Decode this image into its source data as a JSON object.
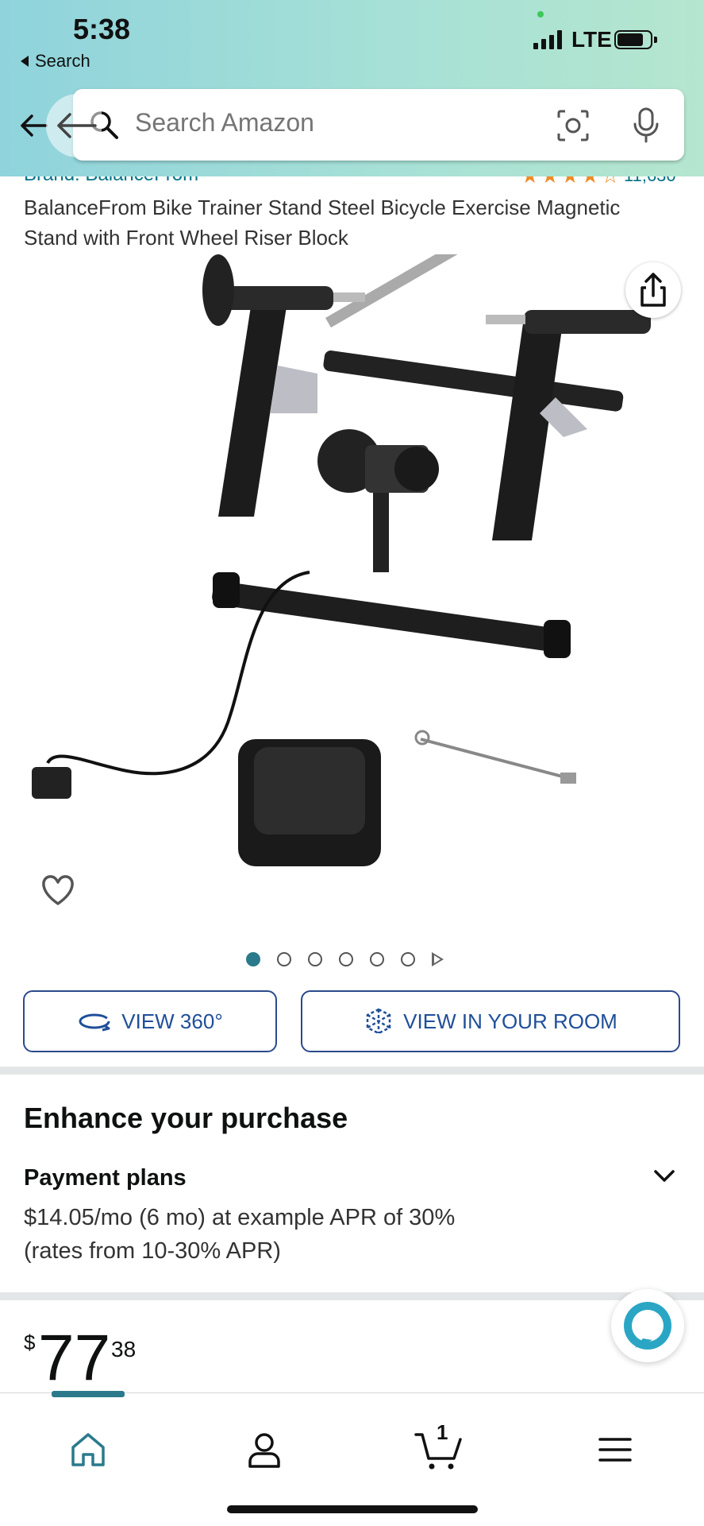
{
  "status_bar": {
    "time": "5:38",
    "back_app_label": "Search",
    "network": "LTE"
  },
  "search": {
    "placeholder": "Search Amazon"
  },
  "product": {
    "brand": "Brand: BalanceFrom",
    "rating_stars": "★★★★☆",
    "rating_count": "11,630",
    "title": "BalanceFrom Bike Trainer Stand Steel Bicycle Exercise Magnetic Stand with Front Wheel Riser Block",
    "image_count": 6,
    "active_image_index": 0
  },
  "view_buttons": {
    "view_360": "VIEW 360°",
    "view_room": "VIEW IN YOUR ROOM"
  },
  "enhance": {
    "title": "Enhance your purchase",
    "payment_title": "Payment plans",
    "payment_line1": "$14.05/mo (6 mo) at example APR of 30%",
    "payment_line2": "(rates from 10-30% APR)"
  },
  "price": {
    "symbol": "$",
    "whole": "77",
    "fraction": "38"
  },
  "bottom_nav": {
    "cart_count": "1",
    "items": [
      "home-icon",
      "account-icon",
      "cart-icon",
      "menu-icon"
    ]
  },
  "colors": {
    "accent_teal": "#2a7a8c",
    "link": "#007185",
    "button_text": "#1f4f99",
    "star": "#f08a24"
  }
}
